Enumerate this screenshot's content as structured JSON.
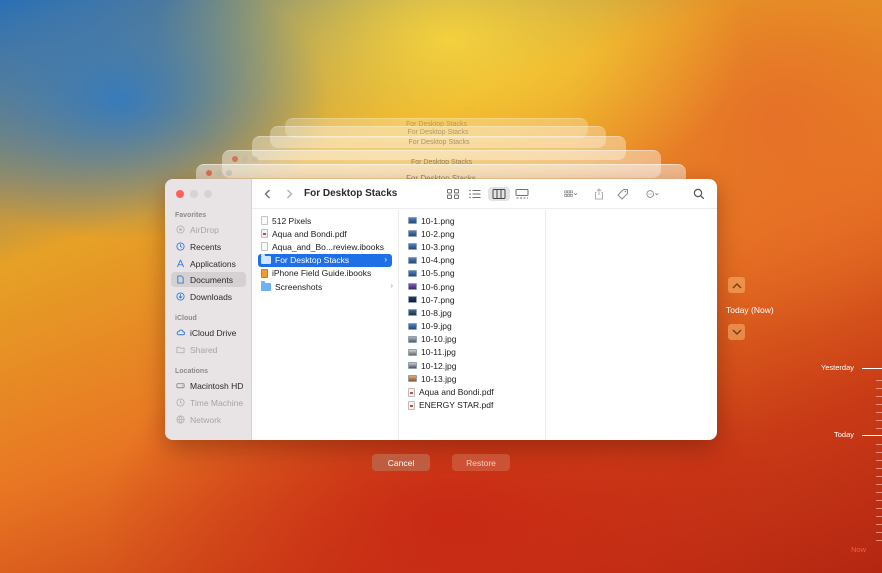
{
  "window": {
    "title": "For Desktop Stacks",
    "ghost_titles": [
      "For Desktop Stacks",
      "For Desktop Stacks",
      "For Desktop Stacks",
      "For Desktop Stacks",
      "For Desktop Stacks"
    ]
  },
  "sidebar": {
    "favorites_label": "Favorites",
    "favorites": [
      {
        "label": "AirDrop",
        "icon": "airdrop-icon",
        "dim": true
      },
      {
        "label": "Recents",
        "icon": "clock-icon"
      },
      {
        "label": "Applications",
        "icon": "applications-icon"
      },
      {
        "label": "Documents",
        "icon": "document-icon",
        "selected": true
      },
      {
        "label": "Downloads",
        "icon": "download-icon"
      }
    ],
    "icloud_label": "iCloud",
    "icloud": [
      {
        "label": "iCloud Drive",
        "icon": "cloud-icon"
      },
      {
        "label": "Shared",
        "icon": "shared-folder-icon",
        "dim": true
      }
    ],
    "locations_label": "Locations",
    "locations": [
      {
        "label": "Macintosh HD",
        "icon": "disk-icon"
      },
      {
        "label": "Time Machine",
        "icon": "time-machine-icon",
        "dim": true
      },
      {
        "label": "Network",
        "icon": "network-icon",
        "dim": true
      }
    ]
  },
  "columns": {
    "first": [
      {
        "label": "512 Pixels",
        "type": "doc"
      },
      {
        "label": "Aqua and Bondi.pdf",
        "type": "pdf"
      },
      {
        "label": "Aqua_and_Bo...review.ibooks",
        "type": "doc"
      },
      {
        "label": "For Desktop Stacks",
        "type": "folder",
        "selected": true,
        "chevron": "›"
      },
      {
        "label": "iPhone Field Guide.ibooks",
        "type": "book"
      },
      {
        "label": "Screenshots",
        "type": "folder",
        "chevron": "›"
      }
    ],
    "second": [
      {
        "label": "10-1.png",
        "type": "img"
      },
      {
        "label": "10-2.png",
        "type": "img"
      },
      {
        "label": "10-3.png",
        "type": "img"
      },
      {
        "label": "10-4.png",
        "type": "img"
      },
      {
        "label": "10-5.png",
        "type": "img"
      },
      {
        "label": "10-6.png",
        "type": "img"
      },
      {
        "label": "10-7.png",
        "type": "img"
      },
      {
        "label": "10-8.jpg",
        "type": "img"
      },
      {
        "label": "10-9.jpg",
        "type": "img"
      },
      {
        "label": "10-10.jpg",
        "type": "img"
      },
      {
        "label": "10-11.jpg",
        "type": "img"
      },
      {
        "label": "10-12.jpg",
        "type": "img"
      },
      {
        "label": "10-13.jpg",
        "type": "img"
      },
      {
        "label": "Aqua and Bondi.pdf",
        "type": "pdf"
      },
      {
        "label": "ENERGY STAR.pdf",
        "type": "pdf"
      }
    ]
  },
  "buttons": {
    "cancel": "Cancel",
    "restore": "Restore"
  },
  "time_machine": {
    "current_label": "Today (Now)",
    "timeline": {
      "yesterday": "Yesterday",
      "today": "Today",
      "now": "Now"
    }
  },
  "colors": {
    "selection": "#1f6fe6",
    "close": "#ff5f57"
  }
}
